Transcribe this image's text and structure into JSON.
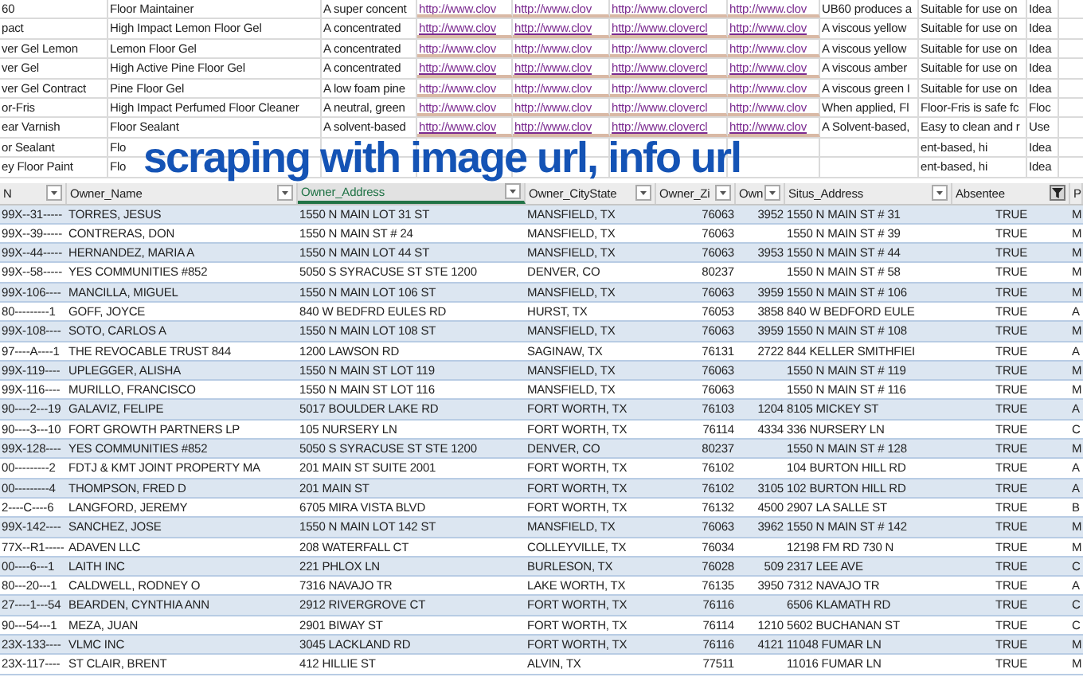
{
  "overlay_title": "scraping with image url, info url",
  "product_rows": [
    {
      "code": "60",
      "name": "Floor Maintainer",
      "description": "A super concent",
      "links": [
        "http://www.clov",
        "http://www.clov",
        "http://www.clovercl",
        "http://www.clov"
      ],
      "summary": "UB60 produces a",
      "usage": "Suitable for use on",
      "extra": "Idea"
    },
    {
      "code": "pact",
      "name": "High Impact Lemon Floor Gel",
      "description": "A concentrated",
      "links": [
        "http://www.clov",
        "http://www.clov",
        "http://www.clovercl",
        "http://www.clov"
      ],
      "summary": "A viscous yellow",
      "usage": "Suitable for use on",
      "extra": "Idea"
    },
    {
      "code": "ver Gel Lemon",
      "name": "Lemon Floor Gel",
      "description": "A concentrated",
      "links": [
        "http://www.clov",
        "http://www.clov",
        "http://www.clovercl",
        "http://www.clov"
      ],
      "summary": "A viscous yellow",
      "usage": "Suitable for use on",
      "extra": "Idea"
    },
    {
      "code": "ver Gel",
      "name": "High Active Pine Floor Gel",
      "description": "A concentrated",
      "links": [
        "http://www.clov",
        "http://www.clov",
        "http://www.clovercl",
        "http://www.clov"
      ],
      "summary": "A viscous amber",
      "usage": "Suitable for use on",
      "extra": "Idea"
    },
    {
      "code": "ver Gel Contract",
      "name": "Pine Floor Gel",
      "description": "A low foam pine",
      "links": [
        "http://www.clov",
        "http://www.clov",
        "http://www.clovercl",
        "http://www.clov"
      ],
      "summary": "A viscous green I",
      "usage": "Suitable for use on",
      "extra": "Idea"
    },
    {
      "code": "or-Fris",
      "name": "High Impact Perfumed Floor Cleaner",
      "description": "A neutral, green",
      "links": [
        "http://www.clov",
        "http://www.clov",
        "http://www.clovercl",
        "http://www.clov"
      ],
      "summary": "When applied, Fl",
      "usage": "Floor-Fris is safe fc",
      "extra": "Floc"
    },
    {
      "code": "ear Varnish",
      "name": "Floor Sealant",
      "description": "A solvent-based",
      "links": [
        "http://www.clov",
        "http://www.clov",
        "http://www.clovercl",
        "http://www.clov"
      ],
      "summary": "A Solvent-based,",
      "usage": "Easy to clean and r",
      "extra": "Use"
    },
    {
      "code": "or Sealant",
      "name": "Flo",
      "usage": "ent-based, hi",
      "extra": "Idea"
    },
    {
      "code": "ey Floor Paint",
      "name": "Flo",
      "usage": "ent-based, hi",
      "extra": "Idea"
    }
  ],
  "columns": [
    {
      "label": "N",
      "selected": false,
      "filtered": false
    },
    {
      "label": "Owner_Name",
      "selected": false,
      "filtered": false
    },
    {
      "label": "Owner_Address",
      "selected": true,
      "filtered": false
    },
    {
      "label": "Owner_CityState",
      "selected": false,
      "filtered": false
    },
    {
      "label": "Owner_Zi",
      "selected": false,
      "filtered": false
    },
    {
      "label": "Own",
      "selected": false,
      "filtered": false
    },
    {
      "label": "Situs_Address",
      "selected": false,
      "filtered": false
    },
    {
      "label": "Absentee",
      "selected": false,
      "filtered": true
    },
    {
      "label": "P",
      "selected": false
    }
  ],
  "rows": [
    {
      "parcel": "99X--31-----",
      "name": "TORRES, JESUS",
      "address": "1550 N MAIN LOT 31 ST",
      "city": "MANSFIELD, TX",
      "zip": "76063",
      "zip4": "3952",
      "situs": "1550 N MAIN ST # 31",
      "absentee": "TRUE",
      "p": "M"
    },
    {
      "parcel": "99X--39-----",
      "name": "CONTRERAS, DON",
      "address": "1550 N MAIN ST # 24",
      "city": "MANSFIELD, TX",
      "zip": "76063",
      "situs": "1550 N MAIN ST # 39",
      "absentee": "TRUE",
      "p": "M"
    },
    {
      "parcel": "99X--44-----",
      "name": "HERNANDEZ, MARIA A",
      "address": "1550 N MAIN LOT 44 ST",
      "city": "MANSFIELD, TX",
      "zip": "76063",
      "zip4": "3953",
      "situs": "1550 N MAIN ST # 44",
      "absentee": "TRUE",
      "p": "M"
    },
    {
      "parcel": "99X--58-----",
      "name": "YES COMMUNITIES #852",
      "address": "5050 S SYRACUSE ST STE 1200",
      "city": "DENVER, CO",
      "zip": "80237",
      "situs": "1550 N MAIN ST # 58",
      "absentee": "TRUE",
      "p": "M"
    },
    {
      "parcel": "99X-106----",
      "name": "MANCILLA, MIGUEL",
      "address": "1550 N MAIN LOT 106 ST",
      "city": "MANSFIELD, TX",
      "zip": "76063",
      "zip4": "3959",
      "situs": "1550 N MAIN ST # 106",
      "absentee": "TRUE",
      "p": "M"
    },
    {
      "parcel": "80---------1",
      "name": "GOFF, JOYCE",
      "address": "840 W BEDFRD EULES RD",
      "city": "HURST, TX",
      "zip": "76053",
      "zip4": "3858",
      "situs": "840 W BEDFORD EULE",
      "absentee": "TRUE",
      "p": "A"
    },
    {
      "parcel": "99X-108----",
      "name": "SOTO, CARLOS A",
      "address": "1550 N MAIN LOT 108 ST",
      "city": "MANSFIELD, TX",
      "zip": "76063",
      "zip4": "3959",
      "situs": "1550 N MAIN ST # 108",
      "absentee": "TRUE",
      "p": "M"
    },
    {
      "parcel": "97----A----1",
      "name": "THE REVOCABLE TRUST 844",
      "address": "1200 LAWSON RD",
      "city": "SAGINAW, TX",
      "zip": "76131",
      "zip4": "2722",
      "situs": "844 KELLER SMITHFIEI",
      "absentee": "TRUE",
      "p": "A"
    },
    {
      "parcel": "99X-119----",
      "name": "UPLEGGER, ALISHA",
      "address": "1550 N MAIN ST LOT 119",
      "city": "MANSFIELD, TX",
      "zip": "76063",
      "situs": "1550 N MAIN ST # 119",
      "absentee": "TRUE",
      "p": "M"
    },
    {
      "parcel": "99X-116----",
      "name": "MURILLO, FRANCISCO",
      "address": "1550 N MAIN ST LOT 116",
      "city": "MANSFIELD, TX",
      "zip": "76063",
      "situs": "1550 N MAIN ST # 116",
      "absentee": "TRUE",
      "p": "M"
    },
    {
      "parcel": "90----2---19",
      "name": "GALAVIZ, FELIPE",
      "address": "5017 BOULDER LAKE RD",
      "city": "FORT WORTH, TX",
      "zip": "76103",
      "zip4": "1204",
      "situs": "8105 MICKEY ST",
      "absentee": "TRUE",
      "p": "A"
    },
    {
      "parcel": "90----3---10",
      "name": "FORT GROWTH PARTNERS LP",
      "address": "105 NURSERY LN",
      "city": "FORT WORTH, TX",
      "zip": "76114",
      "zip4": "4334",
      "situs": "336 NURSERY LN",
      "absentee": "TRUE",
      "p": "C"
    },
    {
      "parcel": "99X-128----",
      "name": "YES COMMUNITIES #852",
      "address": "5050 S SYRACUSE ST STE 1200",
      "city": "DENVER, CO",
      "zip": "80237",
      "situs": "1550 N MAIN ST # 128",
      "absentee": "TRUE",
      "p": "M"
    },
    {
      "parcel": "00---------2",
      "name": "FDTJ & KMT JOINT PROPERTY MA",
      "address": "201 MAIN ST SUITE 2001",
      "city": "FORT WORTH, TX",
      "zip": "76102",
      "situs": "104 BURTON HILL RD",
      "absentee": "TRUE",
      "p": "A"
    },
    {
      "parcel": "00---------4",
      "name": "THOMPSON, FRED D",
      "address": "201 MAIN ST",
      "city": "FORT WORTH, TX",
      "zip": "76102",
      "zip4": "3105",
      "situs": "102 BURTON HILL RD",
      "absentee": "TRUE",
      "p": "A"
    },
    {
      "parcel": "2----C----6",
      "name": "LANGFORD, JEREMY",
      "address": "6705 MIRA VISTA BLVD",
      "city": "FORT WORTH, TX",
      "zip": "76132",
      "zip4": "4500",
      "situs": "2907 LA SALLE ST",
      "absentee": "TRUE",
      "p": "B"
    },
    {
      "parcel": "99X-142----",
      "name": "SANCHEZ, JOSE",
      "address": "1550 N MAIN LOT 142 ST",
      "city": "MANSFIELD, TX",
      "zip": "76063",
      "zip4": "3962",
      "situs": "1550 N MAIN ST # 142",
      "absentee": "TRUE",
      "p": "M"
    },
    {
      "parcel": "77X--R1-----",
      "name": "ADAVEN LLC",
      "address": "208 WATERFALL CT",
      "city": "COLLEYVILLE, TX",
      "zip": "76034",
      "situs": "12198 FM RD 730 N",
      "absentee": "TRUE",
      "p": "M"
    },
    {
      "parcel": "00----6---1",
      "name": "LAITH INC",
      "address": "221 PHLOX LN",
      "city": "BURLESON, TX",
      "zip": "76028",
      "zip4": "509",
      "situs": "2317 LEE AVE",
      "absentee": "TRUE",
      "p": "C"
    },
    {
      "parcel": "80---20---1",
      "name": "CALDWELL, RODNEY O",
      "address": "7316 NAVAJO TR",
      "city": "LAKE WORTH, TX",
      "zip": "76135",
      "zip4": "3950",
      "situs": "7312 NAVAJO TR",
      "absentee": "TRUE",
      "p": "A"
    },
    {
      "parcel": "27----1---54",
      "name": "BEARDEN, CYNTHIA ANN",
      "address": "2912 RIVERGROVE CT",
      "city": "FORT WORTH, TX",
      "zip": "76116",
      "situs": "6506 KLAMATH RD",
      "absentee": "TRUE",
      "p": "C"
    },
    {
      "parcel": "90---54---1",
      "name": "MEZA, JUAN",
      "address": "2901 BIWAY ST",
      "city": "FORT WORTH, TX",
      "zip": "76114",
      "zip4": "1210",
      "situs": "5602 BUCHANAN ST",
      "absentee": "TRUE",
      "p": "C"
    },
    {
      "parcel": "23X-133----",
      "name": "VLMC INC",
      "address": "3045 LACKLAND RD",
      "city": "FORT WORTH, TX",
      "zip": "76116",
      "zip4": "4121",
      "situs": "11048 FUMAR LN",
      "absentee": "TRUE",
      "p": "M"
    },
    {
      "parcel": "23X-117----",
      "name": "ST CLAIR, BRENT",
      "address": "412 HILLIE ST",
      "city": "ALVIN, TX",
      "zip": "77511",
      "situs": "11016 FUMAR LN",
      "absentee": "TRUE",
      "p": "M"
    }
  ]
}
